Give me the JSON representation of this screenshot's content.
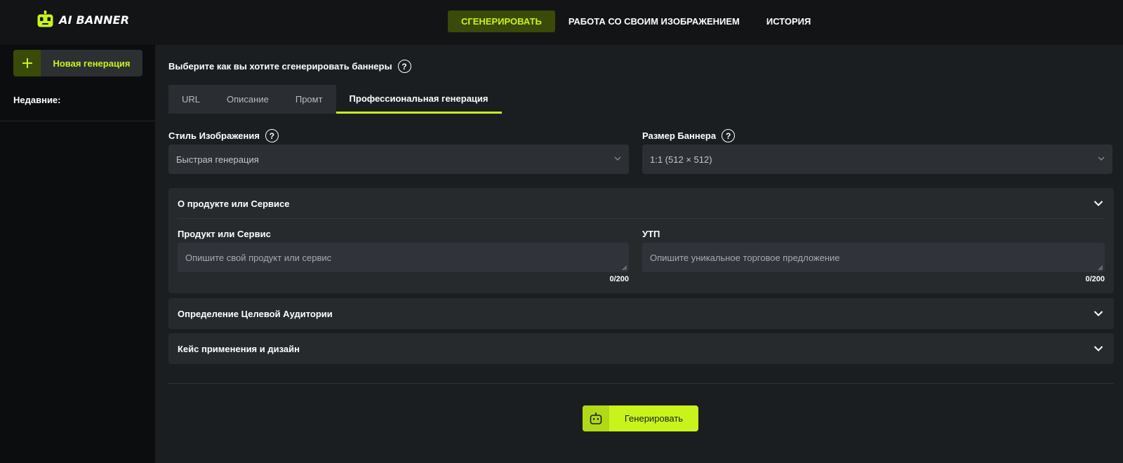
{
  "app": {
    "logo_text": "AI BANNER"
  },
  "nav": {
    "items": [
      {
        "label": "СГЕНЕРИРОВАТЬ",
        "active": true
      },
      {
        "label": "РАБОТА СО СВОИМ ИЗОБРАЖЕНИЕМ",
        "active": false
      },
      {
        "label": "ИСТОРИЯ",
        "active": false
      }
    ]
  },
  "sidebar": {
    "new_generation_label": "Новая генерация",
    "recent_label": "Недавние:"
  },
  "main": {
    "section_title": "Выберите как вы хотите сгенерировать баннеры",
    "tabs": [
      {
        "label": "URL",
        "active": false
      },
      {
        "label": "Описание",
        "active": false
      },
      {
        "label": "Промт",
        "active": false
      },
      {
        "label": "Профессиональная генерация",
        "active": true
      }
    ],
    "image_style": {
      "label": "Стиль Изображения",
      "value": "Быстрая генерация"
    },
    "banner_size": {
      "label": "Размер Баннера",
      "value": "1:1 (512 × 512)"
    },
    "product_panel": {
      "title": "О продукте или Сервисе",
      "product_label": "Продукт или Сервис",
      "product_placeholder": "Опишите свой продукт или сервис",
      "product_counter": "0/200",
      "usp_label": "УТП",
      "usp_placeholder": "Опишите уникальное торговое предложение",
      "usp_counter": "0/200"
    },
    "audience_panel": {
      "title": "Определение Целевой Аудитории"
    },
    "use_case_panel": {
      "title": "Кейс применения и дизайн"
    },
    "generate_button_label": "Генерировать"
  },
  "colors": {
    "accent": "#c8f41b",
    "accent_dark": "#3a4a09",
    "background": "#121416",
    "main_background": "#1b1e21",
    "panel": "#262a2d"
  },
  "icons": {
    "logo": "robot-icon",
    "new_generation": "plus-icon",
    "help": "question-circle-icon",
    "dropdown": "chevron-down-icon",
    "generate": "robot-icon"
  }
}
